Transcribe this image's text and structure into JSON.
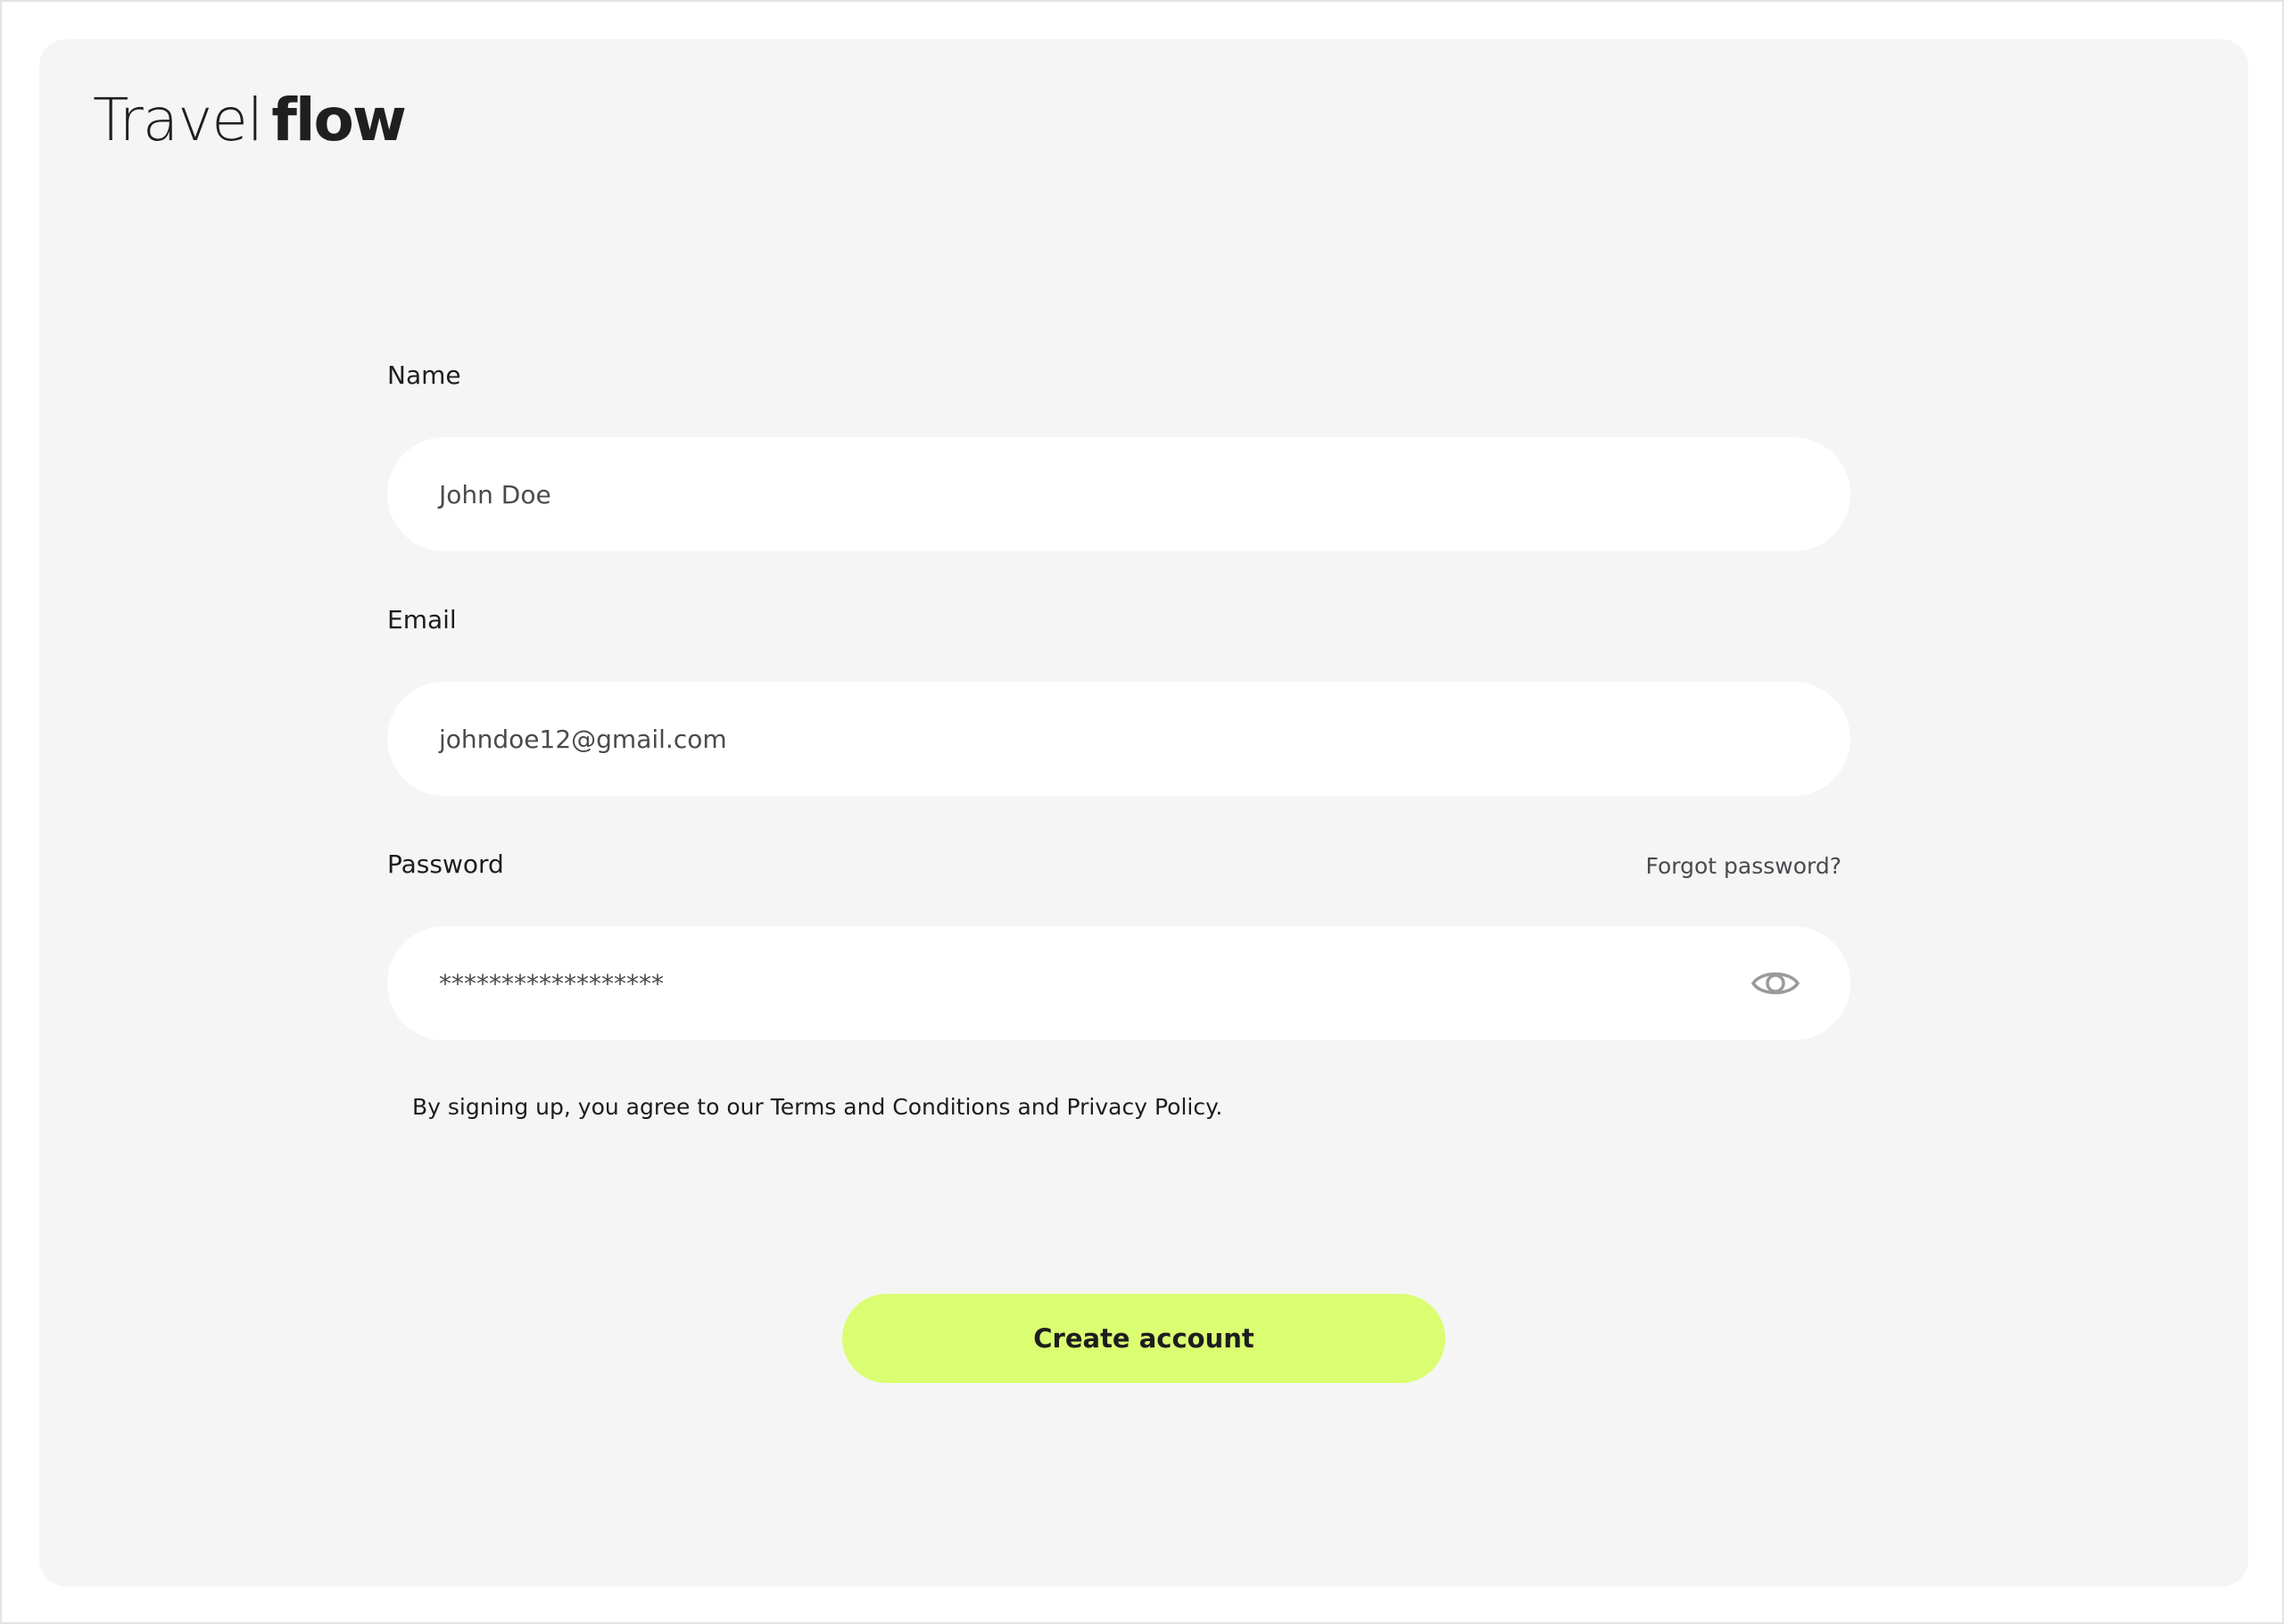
{
  "brand": {
    "logo_light": "Travel",
    "logo_bold": "flow"
  },
  "form": {
    "name": {
      "label": "Name",
      "value": "John Doe"
    },
    "email": {
      "label": "Email",
      "value": "johndoe12@gmail.com"
    },
    "password": {
      "label": "Password",
      "value": "******************",
      "forgot_label": "Forgot password?",
      "toggle_icon": "eye-icon"
    },
    "terms_text": "By signing up, you agree to our Terms and Conditions and Privacy Policy.",
    "submit_label": "Create account"
  },
  "colors": {
    "card_background": "#f5f5f5",
    "input_background": "#ffffff",
    "accent": "#dbfd71",
    "text": "#1d1d1f",
    "muted_text": "#4a4a4f"
  }
}
